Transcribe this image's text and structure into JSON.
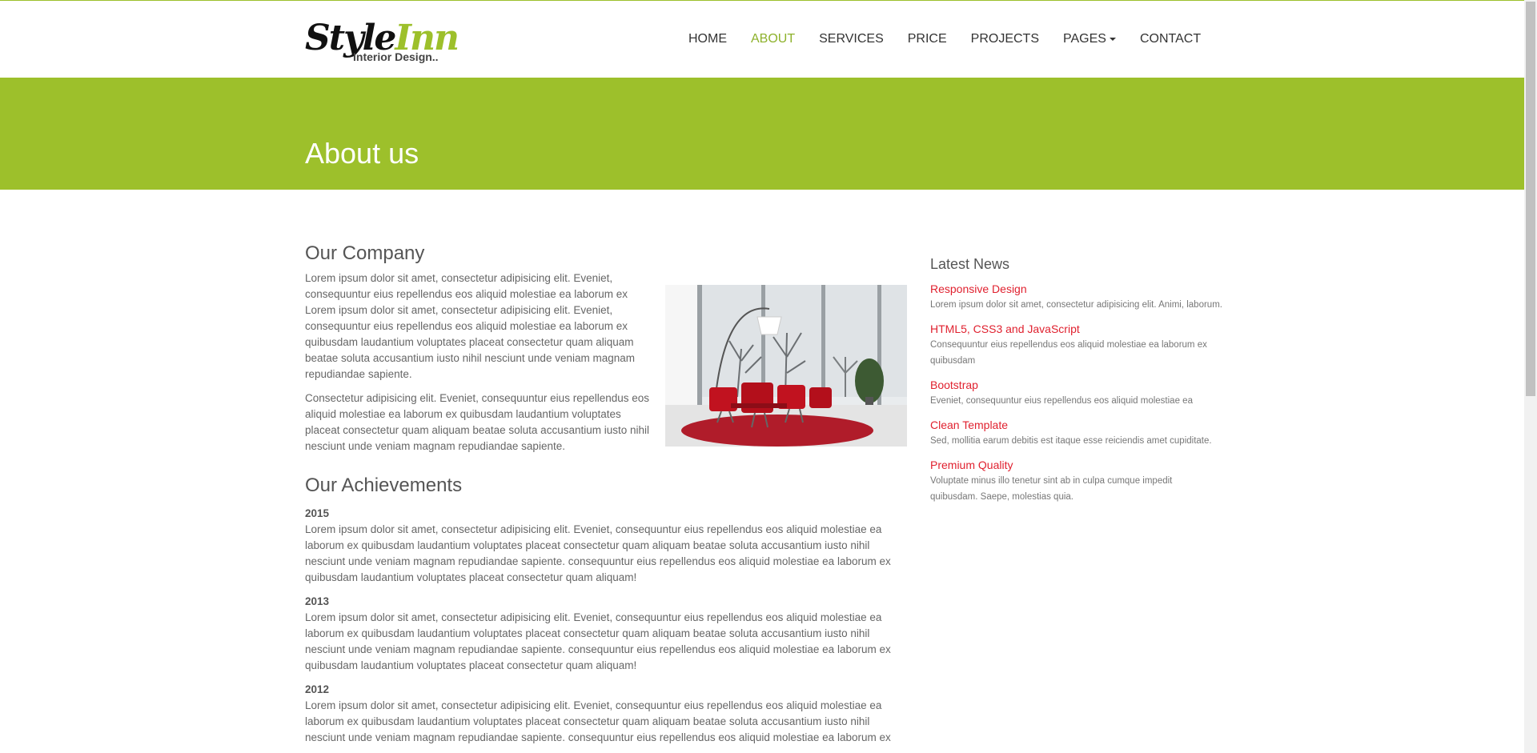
{
  "brand": {
    "logo_part1": "Style",
    "logo_part2": "Inn",
    "tagline": "Interior Design.."
  },
  "nav": {
    "items": [
      {
        "label": "HOME"
      },
      {
        "label": "ABOUT",
        "active": true
      },
      {
        "label": "SERVICES"
      },
      {
        "label": "PRICE"
      },
      {
        "label": "PROJECTS"
      },
      {
        "label": "PAGES"
      },
      {
        "label": "CONTACT"
      }
    ]
  },
  "banner": {
    "title": "About us"
  },
  "company": {
    "heading": "Our Company",
    "paragraphs": [
      "Lorem ipsum dolor sit amet, consectetur adipisicing elit. Eveniet, consequuntur eius repellendus eos aliquid molestiae ea laborum ex Lorem ipsum dolor sit amet, consectetur adipisicing elit. Eveniet, consequuntur eius repellendus eos aliquid molestiae ea laborum ex quibusdam laudantium voluptates placeat consectetur quam aliquam beatae soluta accusantium iusto nihil nesciunt unde veniam magnam repudiandae sapiente.",
      "Consectetur adipisicing elit. Eveniet, consequuntur eius repellendus eos aliquid molestiae ea laborum ex quibusdam laudantium voluptates placeat consectetur quam aliquam beatae soluta accusantium iusto nihil nesciunt unde veniam magnam repudiandae sapiente."
    ]
  },
  "achievements": {
    "heading": "Our Achievements",
    "items": [
      {
        "year": "2015",
        "text": "Lorem ipsum dolor sit amet, consectetur adipisicing elit. Eveniet, consequuntur eius repellendus eos aliquid molestiae ea laborum ex quibusdam laudantium voluptates placeat consectetur quam aliquam beatae soluta accusantium iusto nihil nesciunt unde veniam magnam repudiandae sapiente. consequuntur eius repellendus eos aliquid molestiae ea laborum ex quibusdam laudantium voluptates placeat consectetur quam aliquam!"
      },
      {
        "year": "2013",
        "text": "Lorem ipsum dolor sit amet, consectetur adipisicing elit. Eveniet, consequuntur eius repellendus eos aliquid molestiae ea laborum ex quibusdam laudantium voluptates placeat consectetur quam aliquam beatae soluta accusantium iusto nihil nesciunt unde veniam magnam repudiandae sapiente. consequuntur eius repellendus eos aliquid molestiae ea laborum ex quibusdam laudantium voluptates placeat consectetur quam aliquam!"
      },
      {
        "year": "2012",
        "text": "Lorem ipsum dolor sit amet, consectetur adipisicing elit. Eveniet, consequuntur eius repellendus eos aliquid molestiae ea laborum ex quibusdam laudantium voluptates placeat consectetur quam aliquam beatae soluta accusantium iusto nihil nesciunt unde veniam magnam repudiandae sapiente. consequuntur eius repellendus eos aliquid molestiae ea laborum ex"
      }
    ]
  },
  "news": {
    "heading": "Latest News",
    "items": [
      {
        "title": "Responsive Design",
        "text": "Lorem ipsum dolor sit amet, consectetur adipisicing elit. Animi, laborum."
      },
      {
        "title": "HTML5, CSS3 and JavaScript",
        "text": "Consequuntur eius repellendus eos aliquid molestiae ea laborum ex quibusdam"
      },
      {
        "title": "Bootstrap",
        "text": "Eveniet, consequuntur eius repellendus eos aliquid molestiae ea"
      },
      {
        "title": "Clean Template",
        "text": "Sed, mollitia earum debitis est itaque esse reiciendis amet cupiditate."
      },
      {
        "title": "Premium Quality",
        "text": "Voluptate minus illo tenetur sint ab in culpa cumque impedit quibusdam. Saepe, molestias quia."
      }
    ]
  },
  "colors": {
    "accent": "#9dc02b",
    "nav_active": "#8db12b",
    "news_link": "#e0212f",
    "text": "#666666"
  },
  "icons": {
    "dropdown": "caret-down-icon"
  }
}
